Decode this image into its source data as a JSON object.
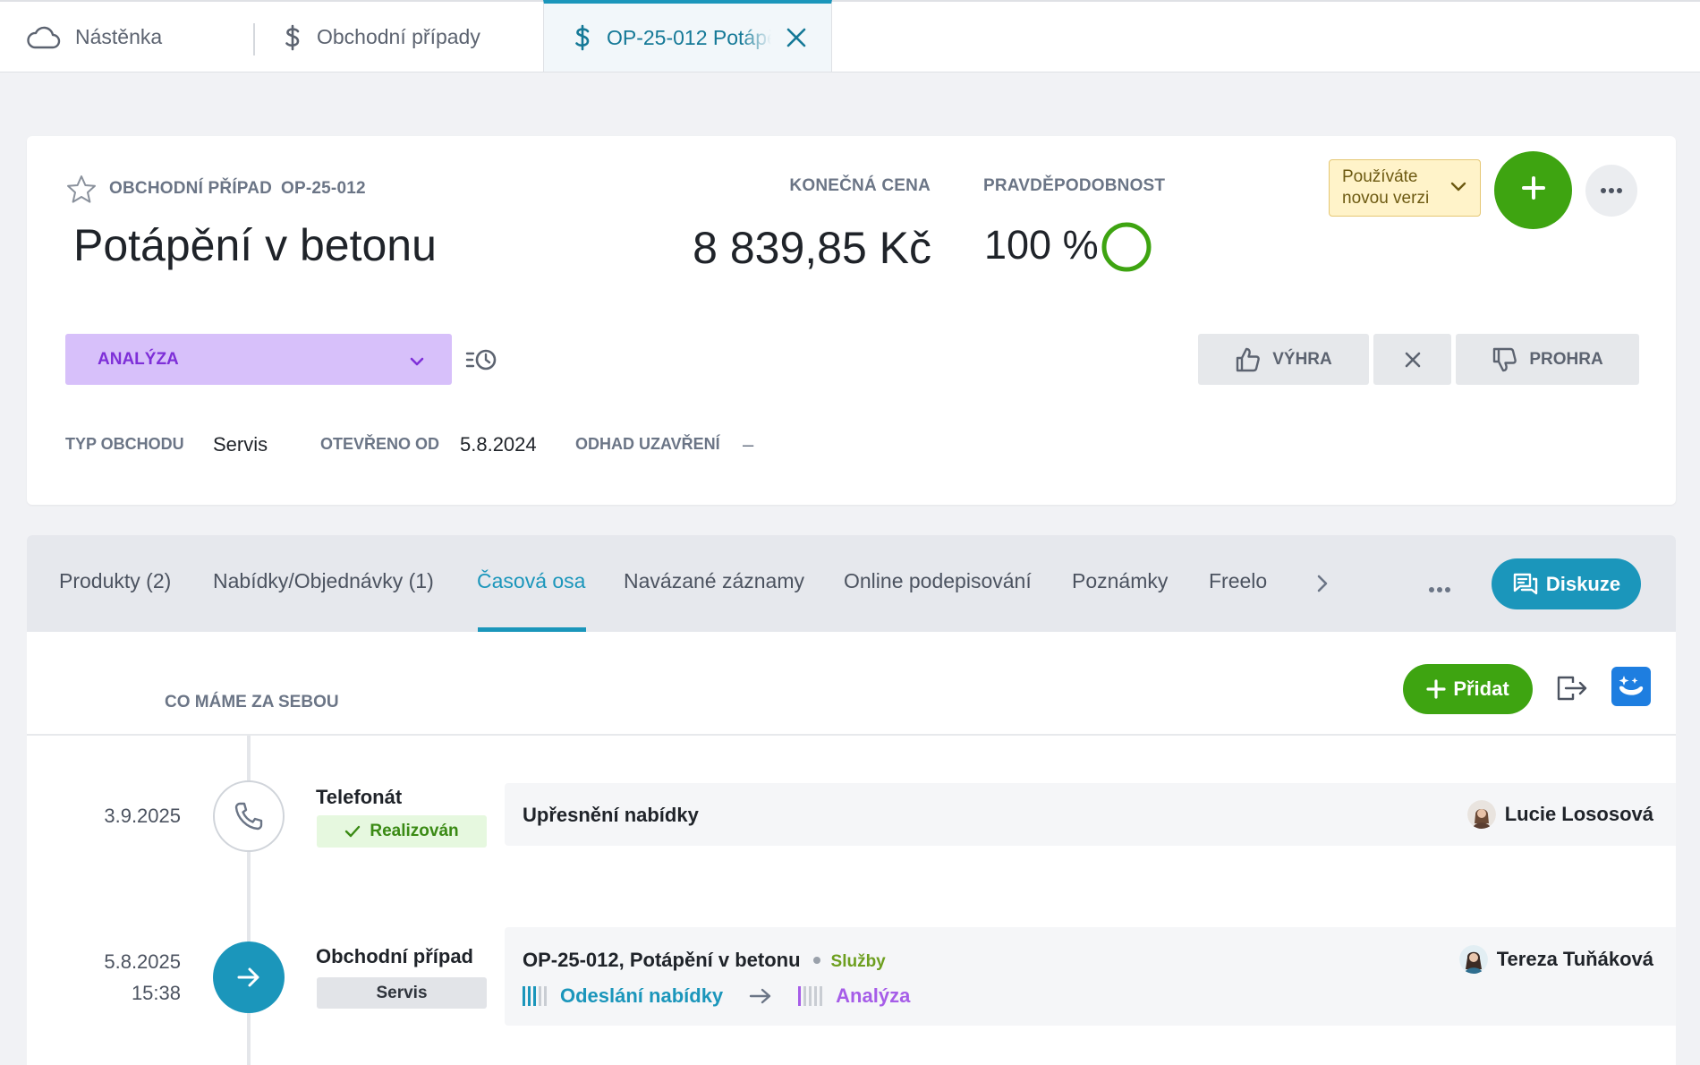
{
  "tabs": {
    "dashboard": "Nástěnka",
    "deals": "Obchodní případy",
    "current": "OP-25-012 Potápění v betonu"
  },
  "header": {
    "type_label": "OBCHODNÍ PŘÍPAD",
    "id": "OP-25-012",
    "title": "Potápění v betonu",
    "price_label": "KONEČNÁ CENA",
    "price": "8 839,85 Kč",
    "probability_label": "PRAVDĚPODOBNOST",
    "probability": "100 %",
    "version_notice": "Používáte novou verzi",
    "stage": "ANALÝZA",
    "win_label": "VÝHRA",
    "lose_label": "PROHRA",
    "meta": {
      "deal_type_label": "TYP OBCHODU",
      "deal_type": "Servis",
      "opened_label": "OTEVŘENO OD",
      "opened": "5.8.2024",
      "close_estimate_label": "ODHAD UZAVŘENÍ",
      "close_estimate": "–"
    }
  },
  "subtabs": {
    "products": "Produkty (2)",
    "offers": "Nabídky/Objednávky (1)",
    "timeline": "Časová osa",
    "linked": "Navázané záznamy",
    "signing": "Online podepisování",
    "notes": "Poznámky",
    "freelo": "Freelo",
    "discussion": "Diskuze"
  },
  "timeline": {
    "section_title": "CO MÁME ZA SEBOU",
    "add_label": "Přidat",
    "items": [
      {
        "date": "3.9.2025",
        "time": "",
        "type": "Telefonát",
        "badge": "Realizován",
        "title": "Upřesnění nabídky",
        "user": "Lucie Lososová"
      },
      {
        "date": "5.8.2025",
        "time": "15:38",
        "type": "Obchodní případ",
        "badge": "Servis",
        "title": "OP-25-012, Potápění v betonu",
        "tag": "Služby",
        "from_stage": "Odeslání nabídky",
        "to_stage": "Analýza",
        "user": "Tereza Tuňáková"
      }
    ]
  },
  "colors": {
    "accent": "#1b96bb",
    "green": "#3ea411",
    "stage_bg": "#d7c0fa",
    "stage_text": "#7e2fd8",
    "version_bg": "#fff3c9"
  },
  "icons": {
    "dashboard_tab": "cloud-icon",
    "deals_tab": "dollar-icon",
    "favorite": "star-icon",
    "probability": "ring-icon",
    "history": "history-icon",
    "win": "thumbs-up-icon",
    "lose": "thumbs-down-icon",
    "phone": "phone-icon",
    "deal_event": "arrow-right-icon",
    "ai": "ai-assistant-icon"
  }
}
